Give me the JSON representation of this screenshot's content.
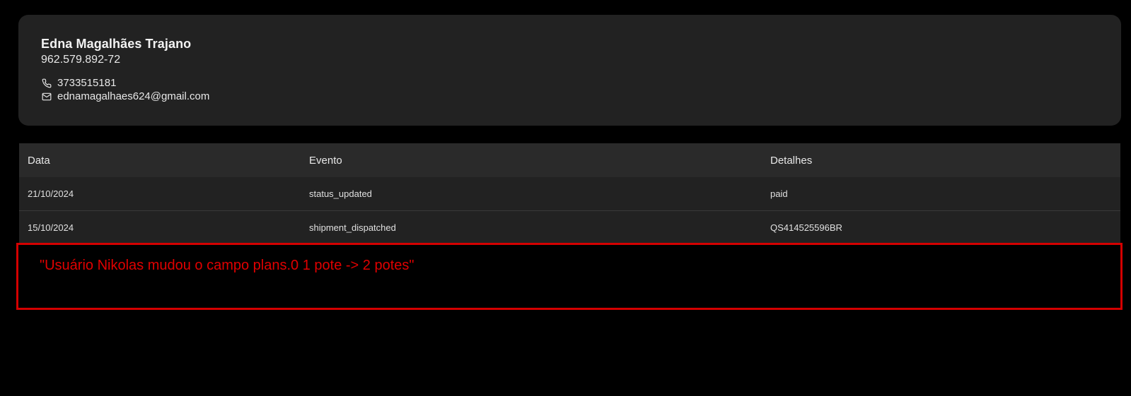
{
  "customer": {
    "name": "Edna Magalhães Trajano",
    "document": "962.579.892-72",
    "phone": "3733515181",
    "email": "ednamagalhaes624@gmail.com",
    "phone_icon": "phone-icon",
    "email_icon": "mail-icon"
  },
  "events": {
    "columns": [
      "Data",
      "Evento",
      "Detalhes"
    ],
    "rows": [
      [
        "21/10/2024",
        "status_updated",
        "paid"
      ],
      [
        "15/10/2024",
        "shipment_dispatched",
        "QS414525596BR"
      ]
    ]
  },
  "annotation": {
    "text": "\"Usuário Nikolas mudou o campo plans.0 1 pote -> 2 potes\"",
    "color": "#e00000"
  },
  "colors": {
    "background": "#000000",
    "card": "#222222",
    "table_header": "#2a2a2a",
    "annotation_border": "#d40000"
  }
}
